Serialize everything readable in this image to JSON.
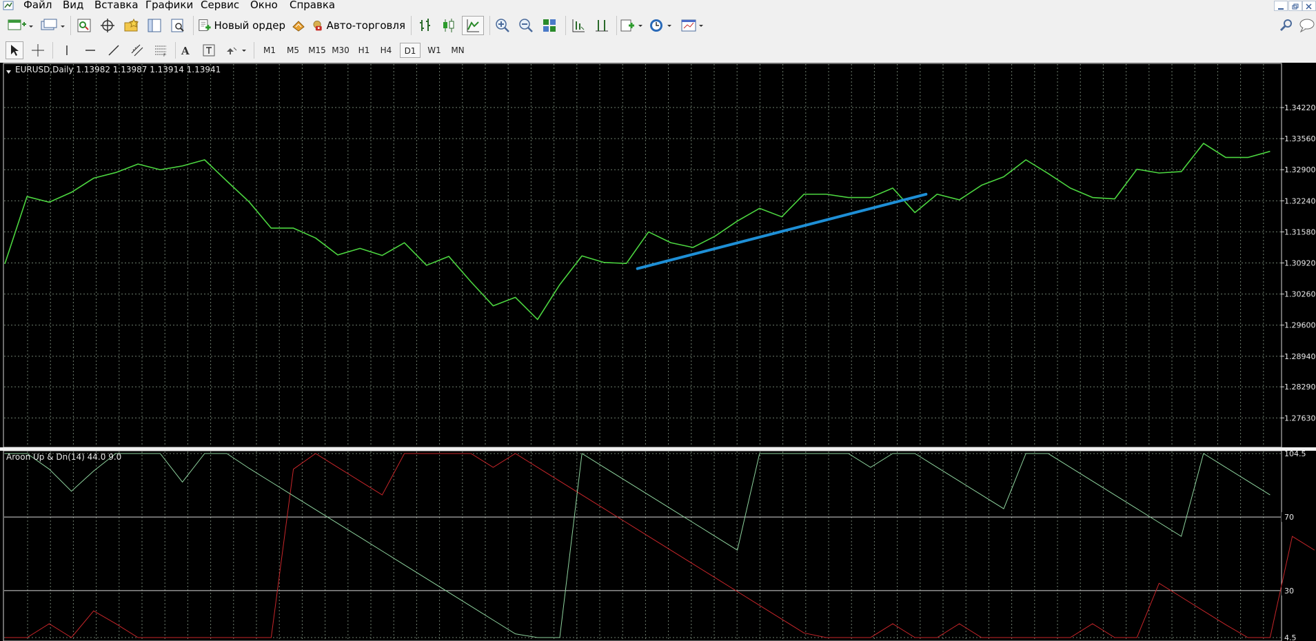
{
  "menu": [
    "Файл",
    "Вид",
    "Вставка",
    "Графики",
    "Сервис",
    "Окно",
    "Справка"
  ],
  "toolbar": {
    "new_order_label": "Новый ордер",
    "auto_trading_label": "Авто-торговля"
  },
  "timeframes": [
    "M1",
    "M5",
    "M15",
    "M30",
    "H1",
    "H4",
    "D1",
    "W1",
    "MN"
  ],
  "active_timeframe": "D1",
  "main_chart": {
    "title": "EURUSD,Daily  1.13982 1.13987 1.13914 1.13941",
    "price_labels": [
      "1.34220",
      "1.33560",
      "1.32900",
      "1.32240",
      "1.31580",
      "1.30920",
      "1.30260",
      "1.29600",
      "1.28940",
      "1.28290",
      "1.27630"
    ]
  },
  "indicator": {
    "title": "Aroon Up & Dn(14) 44.0 9.0",
    "level_labels": [
      "104.5",
      "70",
      "30",
      "4.5"
    ]
  },
  "colors": {
    "background": "#000000",
    "price_line": "#4cd640",
    "trendline": "#1e8fd6",
    "aroon_up": "#8ed39e",
    "aroon_down": "#c8262a",
    "grid": "#6f7f6f",
    "axis_text": "#e8e8e8"
  },
  "chart_data": {
    "type": "line",
    "price_series": [
      1.309,
      1.3233,
      1.3221,
      1.3242,
      1.3272,
      1.3284,
      1.3302,
      1.329,
      1.3298,
      1.3311,
      1.3266,
      1.3222,
      1.3166,
      1.3166,
      1.3145,
      1.3109,
      1.3123,
      1.3108,
      1.3135,
      1.3087,
      1.3106,
      1.3052,
      1.3001,
      1.3019,
      1.2972,
      1.3046,
      1.3107,
      1.3093,
      1.3091,
      1.3158,
      1.3135,
      1.3125,
      1.3149,
      1.3181,
      1.3208,
      1.319,
      1.3238,
      1.3238,
      1.3231,
      1.3231,
      1.3251,
      1.3199,
      1.3238,
      1.3226,
      1.3257,
      1.3275,
      1.3311,
      1.3282,
      1.3251,
      1.3231,
      1.3228,
      1.3291,
      1.3283,
      1.3286,
      1.3346,
      1.3316,
      1.3316,
      1.3329
    ],
    "trendline": {
      "start_index": 28.5,
      "start_value": 1.308,
      "end_index": 41.5,
      "end_value": 1.3238
    },
    "price_range": [
      1.2743,
      1.3444
    ],
    "aroon_up": [
      104.5,
      104.5,
      96,
      84,
      95,
      104.5,
      104.5,
      104.5,
      89,
      104.5,
      104.5,
      96.5,
      89,
      81.5,
      74,
      66.5,
      59,
      51.5,
      44,
      36.5,
      29,
      21.5,
      14,
      6.5,
      4.5,
      4.5,
      104.5,
      97,
      89.5,
      82,
      74.5,
      67,
      59.5,
      52,
      104.5,
      104.5,
      104.5,
      104.5,
      104.5,
      97,
      104.5,
      104.5,
      97,
      89.5,
      82,
      74.5,
      104.5,
      104.5,
      97,
      89.5,
      82,
      74.5,
      67,
      59.5,
      104.5,
      97,
      89.5,
      82
    ],
    "aroon_down": [
      4.5,
      4.5,
      12,
      4.5,
      19,
      12,
      4.5,
      4.5,
      4.5,
      4.5,
      4.5,
      4.5,
      4.5,
      96,
      104.5,
      97,
      89.5,
      82,
      104.5,
      104.5,
      104.5,
      104.5,
      97,
      104.5,
      97,
      89.5,
      82,
      74.5,
      67,
      59.5,
      52,
      44.5,
      37,
      29.5,
      22,
      14.5,
      7,
      4.5,
      4.5,
      4.5,
      12,
      4.5,
      4.5,
      12,
      4.5,
      4.5,
      4.5,
      4.5,
      4.5,
      12,
      4.5,
      4.5,
      34,
      26.5,
      19,
      11.5,
      4.5,
      4.5,
      59.5,
      52
    ],
    "aroon_range": [
      4.5,
      104.5
    ],
    "aroon_levels": [
      70,
      30
    ]
  }
}
